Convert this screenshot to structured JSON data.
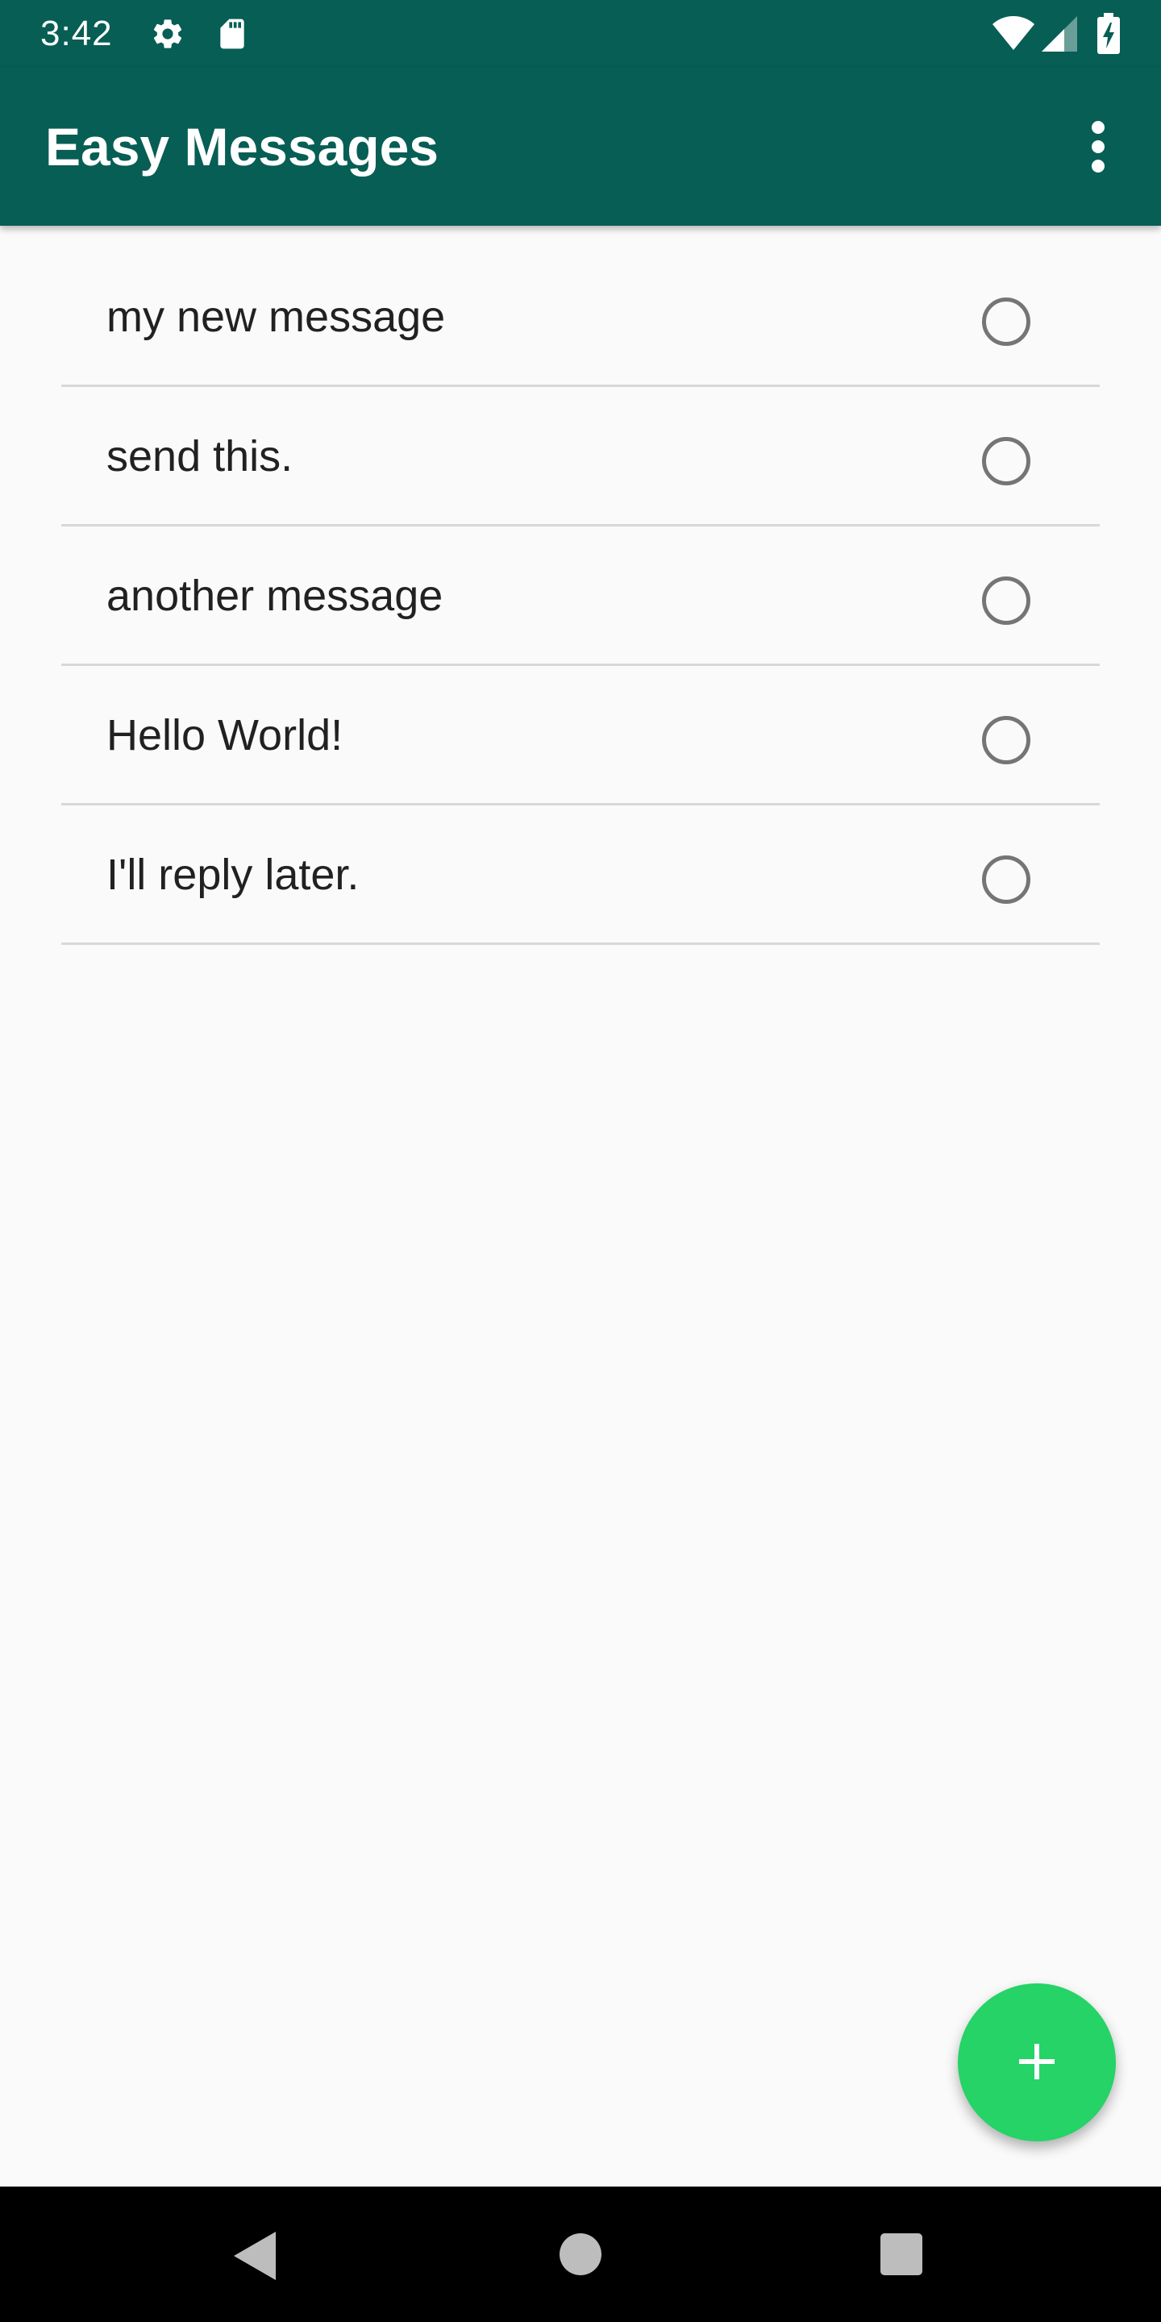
{
  "status_bar": {
    "time": "3:42",
    "icons": [
      "gear-icon",
      "sdcard-icon",
      "wifi-icon",
      "signal-icon",
      "battery-charging-icon"
    ]
  },
  "app_bar": {
    "title": "Easy Messages",
    "overflow_icon": "more-vert-icon"
  },
  "messages": [
    {
      "text": "my  new message",
      "selected": false
    },
    {
      "text": "send this.",
      "selected": false
    },
    {
      "text": "another message",
      "selected": false
    },
    {
      "text": "Hello World!",
      "selected": false
    },
    {
      "text": "I'll reply later.",
      "selected": false
    }
  ],
  "fab": {
    "icon": "add-icon"
  },
  "navigation": {
    "icons": [
      "back-icon",
      "home-icon",
      "recents-icon"
    ]
  },
  "colors": {
    "primary": "#075e54",
    "accent": "#25d366",
    "background": "#fafafa",
    "divider": "#d8d8d8",
    "radio": "#757575"
  }
}
